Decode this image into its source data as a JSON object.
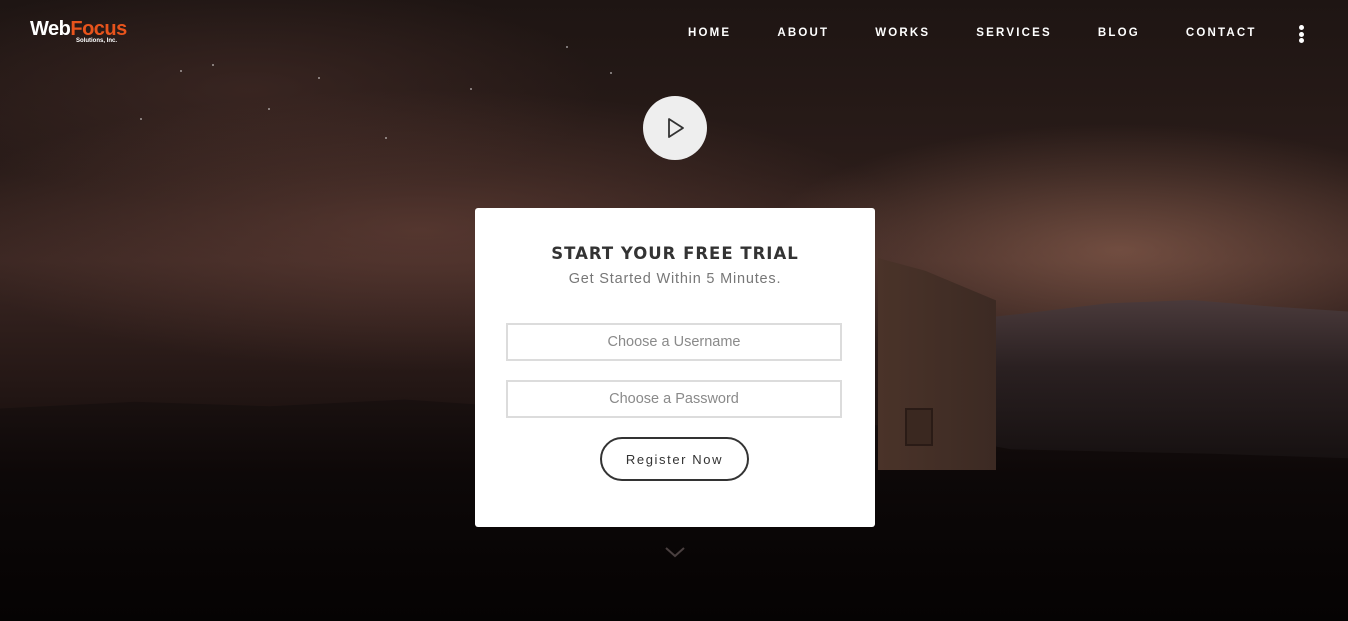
{
  "header": {
    "logo": {
      "brand_part1": "Web",
      "brand_part2": "Focus",
      "tagline": "Solutions, Inc."
    },
    "nav": [
      {
        "label": "HOME"
      },
      {
        "label": "ABOUT"
      },
      {
        "label": "WORKS"
      },
      {
        "label": "SERVICES"
      },
      {
        "label": "BLOG"
      },
      {
        "label": "CONTACT"
      }
    ],
    "menu_icon": "vertical-dots-icon"
  },
  "hero": {
    "play_icon": "play-icon",
    "scroll_icon": "chevron-down-icon"
  },
  "trial_form": {
    "title": "START YOUR FREE TRIAL",
    "subtitle": "Get Started Within 5 Minutes.",
    "username_placeholder": "Choose a Username",
    "username_value": "",
    "password_placeholder": "Choose a Password",
    "password_value": "",
    "submit_label": "Register Now"
  },
  "colors": {
    "brand_accent": "#e8541c",
    "card_background": "#ffffff",
    "text_dark": "#333333"
  }
}
